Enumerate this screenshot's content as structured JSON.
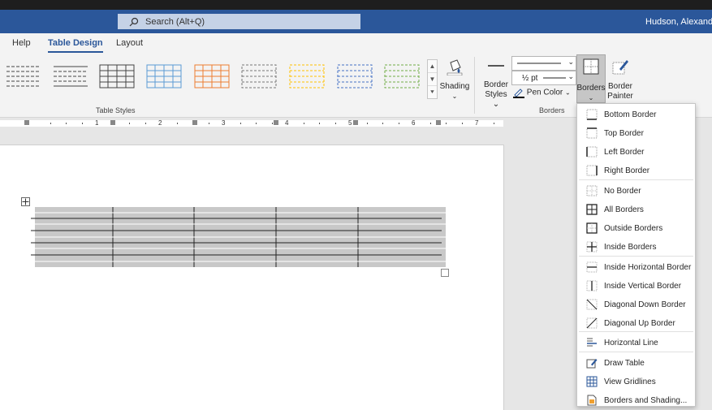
{
  "app": {
    "search_placeholder": "Search (Alt+Q)",
    "user_name": "Hudson, Alexandra"
  },
  "tabs": [
    {
      "label": "Help"
    },
    {
      "label": "Table Design"
    },
    {
      "label": "Layout"
    }
  ],
  "ribbon": {
    "table_styles_label": "Table Styles",
    "shading_label": "Shading",
    "border_styles_label": [
      "Border",
      "Styles"
    ],
    "line_weight": "½ pt",
    "pen_color_label": "Pen Color",
    "borders_label": "Borders",
    "border_painter_label": [
      "Border",
      "Painter"
    ],
    "borders_group_label": "Borders"
  },
  "ruler": {
    "numbers": [
      "1",
      "2",
      "3",
      "4",
      "5",
      "6",
      "7"
    ]
  },
  "borders_menu": {
    "items": [
      {
        "label": "Bottom Border",
        "icon": "bottom-border-icon"
      },
      {
        "label": "Top Border",
        "icon": "top-border-icon"
      },
      {
        "label": "Left Border",
        "icon": "left-border-icon"
      },
      {
        "label": "Right Border",
        "icon": "right-border-icon"
      },
      {
        "label": "No Border",
        "icon": "no-border-icon"
      },
      {
        "label": "All Borders",
        "icon": "all-borders-icon"
      },
      {
        "label": "Outside Borders",
        "icon": "outside-borders-icon"
      },
      {
        "label": "Inside Borders",
        "icon": "inside-borders-icon"
      },
      {
        "label": "Inside Horizontal Border",
        "icon": "inside-horizontal-border-icon"
      },
      {
        "label": "Inside Vertical Border",
        "icon": "inside-vertical-border-icon"
      },
      {
        "label": "Diagonal Down Border",
        "icon": "diagonal-down-border-icon"
      },
      {
        "label": "Diagonal Up Border",
        "icon": "diagonal-up-border-icon"
      },
      {
        "label": "Horizontal Line",
        "icon": "horizontal-line-icon"
      },
      {
        "label": "Draw Table",
        "icon": "draw-table-icon"
      },
      {
        "label": "View Gridlines",
        "icon": "view-gridlines-icon"
      },
      {
        "label": "Borders and Shading...",
        "icon": "borders-and-shading-icon"
      }
    ]
  },
  "colors": {
    "brand": "#2b579a",
    "table_shading": "#c8c8c8",
    "pen_color": "#000000"
  }
}
